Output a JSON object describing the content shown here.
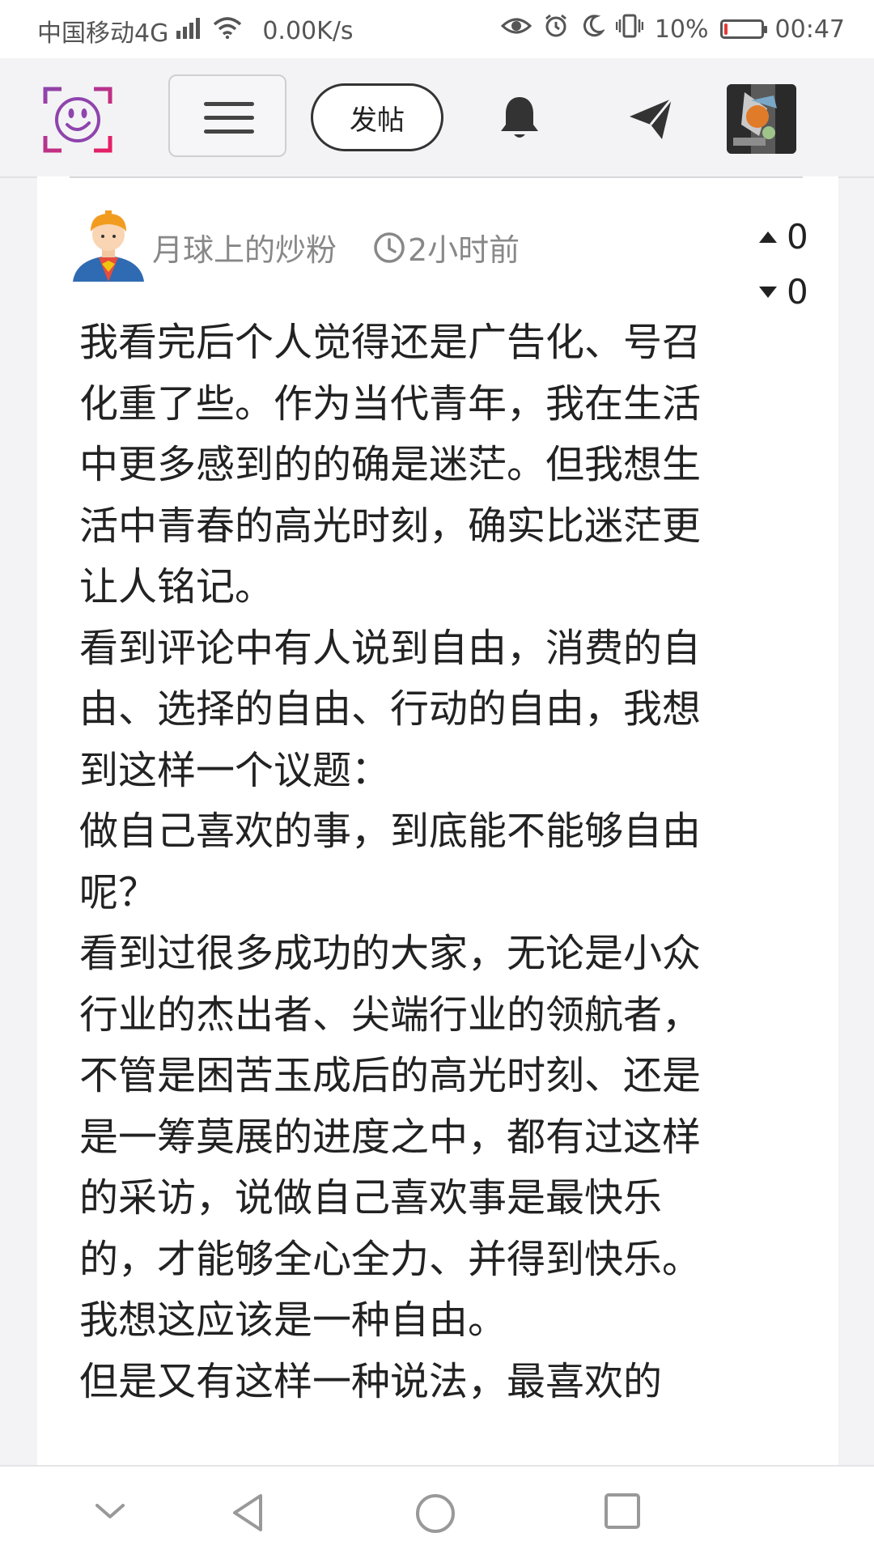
{
  "status_bar": {
    "carrier": "中国移动4G",
    "network_badge": "4G",
    "net_speed": "0.00K/s",
    "battery_percent": "10%",
    "battery_level": 0.1,
    "time": "00:47",
    "icons": [
      "signal-icon",
      "wifi-icon",
      "eye-icon",
      "alarm-icon",
      "moon-icon",
      "vibrate-icon",
      "battery-icon"
    ]
  },
  "nav": {
    "post_button_label": "发帖",
    "icons": [
      "logo-icon",
      "menu-icon",
      "bell-icon",
      "send-icon",
      "user-avatar"
    ]
  },
  "post": {
    "author": "月球上的炒粉",
    "time": "2小时前",
    "upvotes": "0",
    "downvotes": "0",
    "paragraphs": [
      "我看完后个人觉得还是广告化、号召化重了些。作为当代青年，我在生活中更多感到的的确是迷茫。但我想生活中青春的高光时刻，确实比迷茫更让人铭记。",
      "看到评论中有人说到自由，消费的自由、选择的自由、行动的自由，我想到这样一个议题：",
      "做自己喜欢的事，到底能不能够自由呢？",
      "看到过很多成功的大家，无论是小众行业的杰出者、尖端行业的领航者，不管是困苦玉成后的高光时刻、还是是一筹莫展的进度之中，都有过这样的采访，说做自己喜欢事是最快乐的，才能够全心全力、并得到快乐。我想这应该是一种自由。",
      "但是又有这样一种说法，最喜欢的"
    ]
  },
  "system_nav": {
    "icons": [
      "collapse-icon",
      "back-icon",
      "home-icon",
      "recents-icon"
    ]
  },
  "colors": {
    "background": "#f3f3f5",
    "card": "#ffffff",
    "logo_purple": "#8e44ad",
    "logo_pink": "#e91e63",
    "battery_low": "#e53935"
  }
}
